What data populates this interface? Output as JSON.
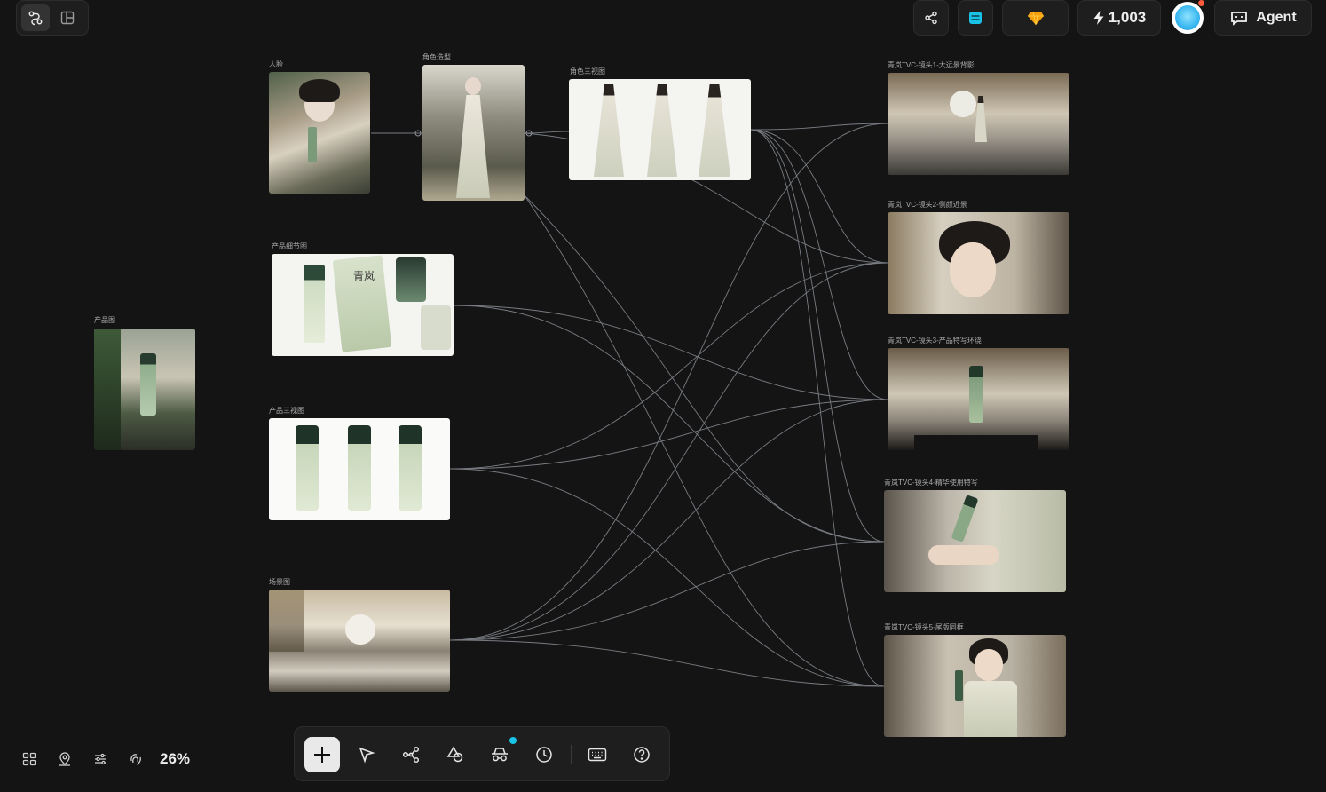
{
  "top_right": {
    "credits": "1,003",
    "agent_label": "Agent"
  },
  "nodes": {
    "portrait": {
      "label": "人脸"
    },
    "character_look": {
      "label": "角色造型"
    },
    "character_three_view": {
      "label": "角色三视图"
    },
    "product_detail": {
      "label": "产品细节图"
    },
    "product_image": {
      "label": "产品图"
    },
    "product_three_view": {
      "label": "产品三视图"
    },
    "scene": {
      "label": "场景图"
    },
    "shot1": {
      "label": "青岚TVC-镜头1-大远景背影"
    },
    "shot2": {
      "label": "青岚TVC-镜头2-侧颜近景"
    },
    "shot3": {
      "label": "青岚TVC-镜头3-产品特写环绕"
    },
    "shot4": {
      "label": "青岚TVC-镜头4-精华使用特写"
    },
    "shot5": {
      "label": "青岚TVC-镜头5-尾版同框"
    }
  },
  "product_detail_text": {
    "brand_char": "青岚"
  },
  "toolbar": {
    "zoom": "26%"
  },
  "colors": {
    "background": "#141414",
    "edge": "#8a8f96",
    "accent_cyan": "#19c3e6",
    "accent_orange": "#f59e0b",
    "notification": "#ff5a3c"
  },
  "icons": [
    "workflow-icon",
    "layout-icon",
    "share-icon",
    "storage-icon",
    "gem-icon",
    "lightning-icon",
    "agent-icon",
    "add-icon",
    "cursor-icon",
    "nodes-icon",
    "shapes-icon",
    "spy-icon",
    "history-icon",
    "keyboard-icon",
    "help-icon",
    "grid-icon",
    "location-icon",
    "filter-icon",
    "fingerprint-icon"
  ]
}
